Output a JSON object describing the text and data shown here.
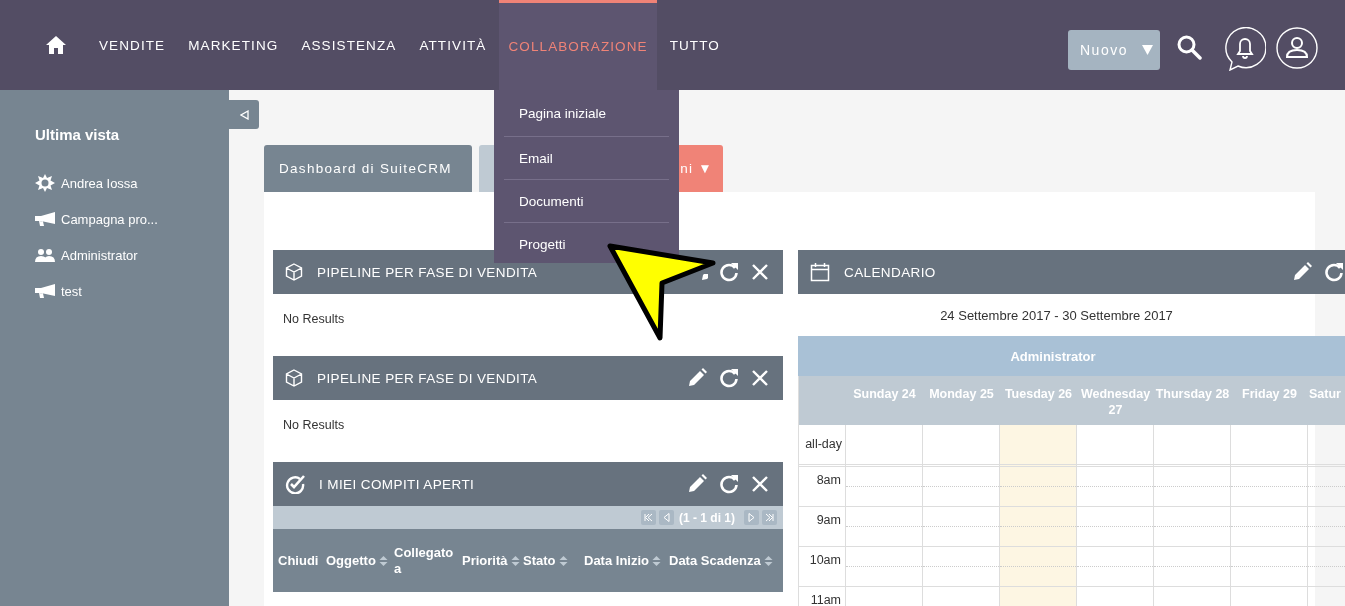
{
  "nav": {
    "items": [
      {
        "label": "VENDITE",
        "selected": false
      },
      {
        "label": "MARKETING",
        "selected": false
      },
      {
        "label": "ASSISTENZA",
        "selected": false
      },
      {
        "label": "ATTIVITÀ",
        "selected": false
      },
      {
        "label": "COLLABORAZIONE",
        "selected": true
      },
      {
        "label": "TUTTO",
        "selected": false
      }
    ],
    "new_button": {
      "label": "Nuovo"
    }
  },
  "menu": {
    "items": [
      "Pagina iniziale",
      "Email",
      "Documenti",
      "Progetti"
    ]
  },
  "sidebar": {
    "title": "Ultima vista",
    "items": [
      {
        "label": "Andrea Iossa",
        "kind": "contact"
      },
      {
        "label": "Campagna pro...",
        "kind": "campaign"
      },
      {
        "label": "Administrator",
        "kind": "user"
      },
      {
        "label": "test",
        "kind": "campaign"
      }
    ]
  },
  "tabs": [
    {
      "label": "Dashboard di SuiteCRM",
      "selected": true
    },
    {
      "selected": false
    }
  ],
  "actions_button": {
    "label": "ni ▼"
  },
  "dashlets": [
    {
      "kind": "pipeline",
      "title": "PIPELINE PER FASE DI VENDITA",
      "body": "No Results"
    },
    {
      "kind": "pipeline",
      "title": "PIPELINE PER FASE DI VENDITA",
      "body": "No Results"
    },
    {
      "kind": "tasks",
      "title": "I MIEI COMPITI APERTI",
      "pagination": "(1 - 1 di 1)",
      "columns": [
        {
          "label": "Chiudi",
          "sortable": false
        },
        {
          "label": "Oggetto",
          "sortable": true
        },
        {
          "label": "Collegato a",
          "sortable": false
        },
        {
          "label": "Priorità",
          "sortable": true
        },
        {
          "label": "Stato",
          "sortable": true
        },
        {
          "label": "Data Inizio",
          "sortable": true
        },
        {
          "label": "Data Scadenza",
          "sortable": true
        }
      ]
    }
  ],
  "calendar": {
    "title": "CALENDARIO",
    "range": "24 Settembre 2017 - 30 Settembre 2017",
    "user": "Administrator",
    "days": [
      {
        "label": "Sunday 24",
        "today": false
      },
      {
        "label": "Monday 25",
        "today": false
      },
      {
        "label": "Tuesday 26",
        "today": true
      },
      {
        "label": "Wednesday 27",
        "today": false
      },
      {
        "label": "Thursday 28",
        "today": false
      },
      {
        "label": "Friday 29",
        "today": false
      },
      {
        "label": "Satur",
        "today": false
      }
    ],
    "rows": [
      "all-day",
      "8am",
      "9am",
      "10am",
      "11am"
    ]
  }
}
